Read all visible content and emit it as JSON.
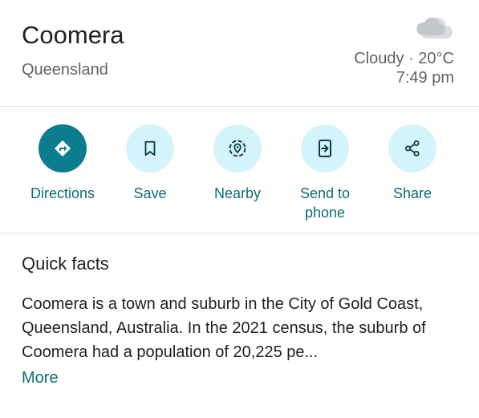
{
  "place": {
    "name": "Coomera",
    "region": "Queensland"
  },
  "weather": {
    "condition_temp": "Cloudy · 20°C",
    "time": "7:49 pm",
    "icon": "cloud-icon"
  },
  "actions": [
    {
      "label": "Directions",
      "icon": "directions-icon"
    },
    {
      "label": "Save",
      "icon": "bookmark-icon"
    },
    {
      "label": "Nearby",
      "icon": "nearby-icon"
    },
    {
      "label": "Send to phone",
      "icon": "send-to-phone-icon"
    },
    {
      "label": "Share",
      "icon": "share-icon"
    }
  ],
  "quick_facts": {
    "title": "Quick facts",
    "body": "Coomera is a town and suburb in the City of Gold Coast, Queensland, Australia. In the 2021 census, the suburb of Coomera had a population of 20,225 pe...",
    "more_label": "More"
  },
  "colors": {
    "accent": "#0b7d8f",
    "accent_text": "#0b6c79",
    "button_bg": "#d5f3fb",
    "secondary_text": "#5f6368"
  }
}
